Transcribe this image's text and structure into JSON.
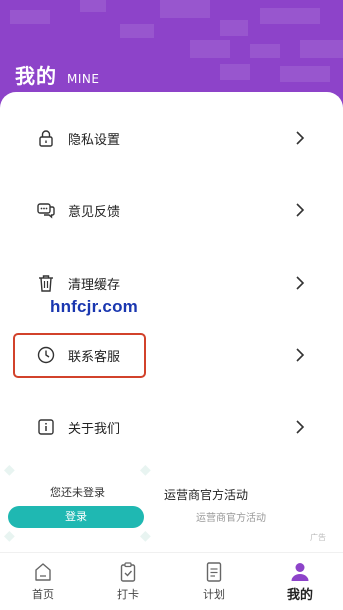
{
  "header": {
    "title": "我的",
    "subtitle": "MINE",
    "bg_color": "#8d43c9"
  },
  "menu": {
    "items": [
      {
        "label": "隐私设置",
        "icon": "lock-icon"
      },
      {
        "label": "意见反馈",
        "icon": "feedback-chat-icon"
      },
      {
        "label": "清理缓存",
        "icon": "trash-icon"
      },
      {
        "label": "联系客服",
        "icon": "clock-icon"
      },
      {
        "label": "关于我们",
        "icon": "info-icon"
      }
    ]
  },
  "watermark": "hnfcjr.com",
  "ad": {
    "login_prompt": "您还未登录",
    "login_button": "登录",
    "title": "运营商官方活动",
    "subtitle": "运营商官方活动",
    "badge": "广告",
    "button_color": "#1fb8b2"
  },
  "tabbar": {
    "tabs": [
      {
        "label": "首页",
        "icon": "home-icon"
      },
      {
        "label": "打卡",
        "icon": "clipboard-check-icon"
      },
      {
        "label": "计划",
        "icon": "document-list-icon"
      },
      {
        "label": "我的",
        "icon": "person-icon",
        "active": true
      }
    ],
    "active_color": "#8d43c9"
  }
}
